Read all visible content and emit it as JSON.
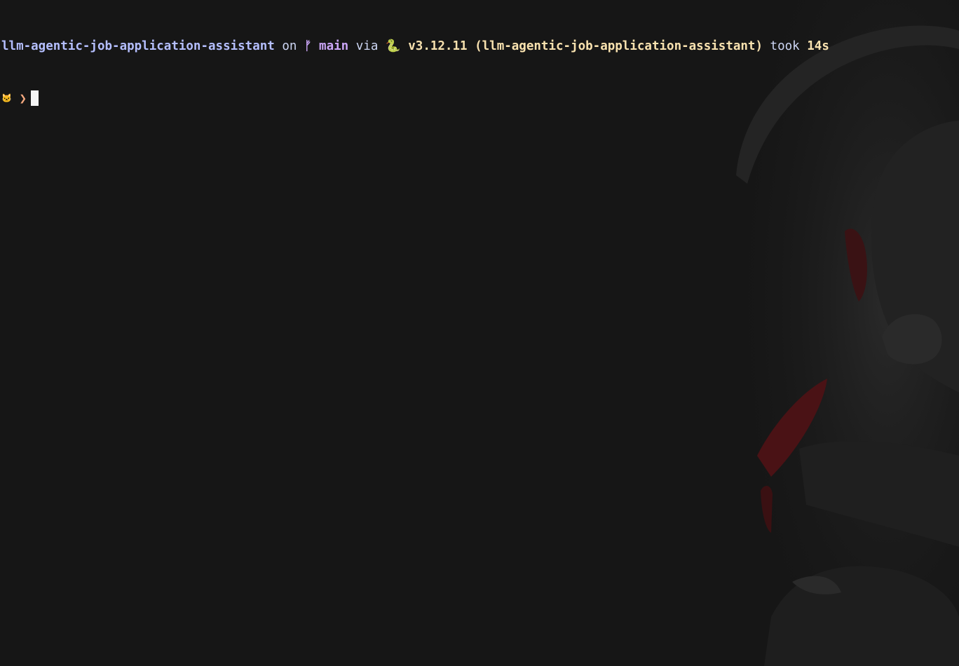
{
  "prompt": {
    "directory": "llm-agentic-job-application-assistant",
    "on_word": "on",
    "branch_icon": "git-branch-icon",
    "branch_glyph": "ᚠ",
    "branch": "main",
    "via_word": "via",
    "python_icon": "python-snake-icon",
    "python_glyph": "🐍",
    "python_version": "v3.12.11",
    "venv": "(llm-agentic-job-application-assistant)",
    "took_word": "took",
    "duration": "14s",
    "input_icon": "cat-icon",
    "input_glyph": "🐱",
    "input_arrow": "❯",
    "input_value": ""
  },
  "colors": {
    "background": "#161616",
    "directory": "#b4befe",
    "branch": "#cba6f7",
    "python": "#f9e2af",
    "arrow": "#f5a97f",
    "cursor": "#f5f5f5",
    "wallpaper_accent": "#5a1416"
  }
}
